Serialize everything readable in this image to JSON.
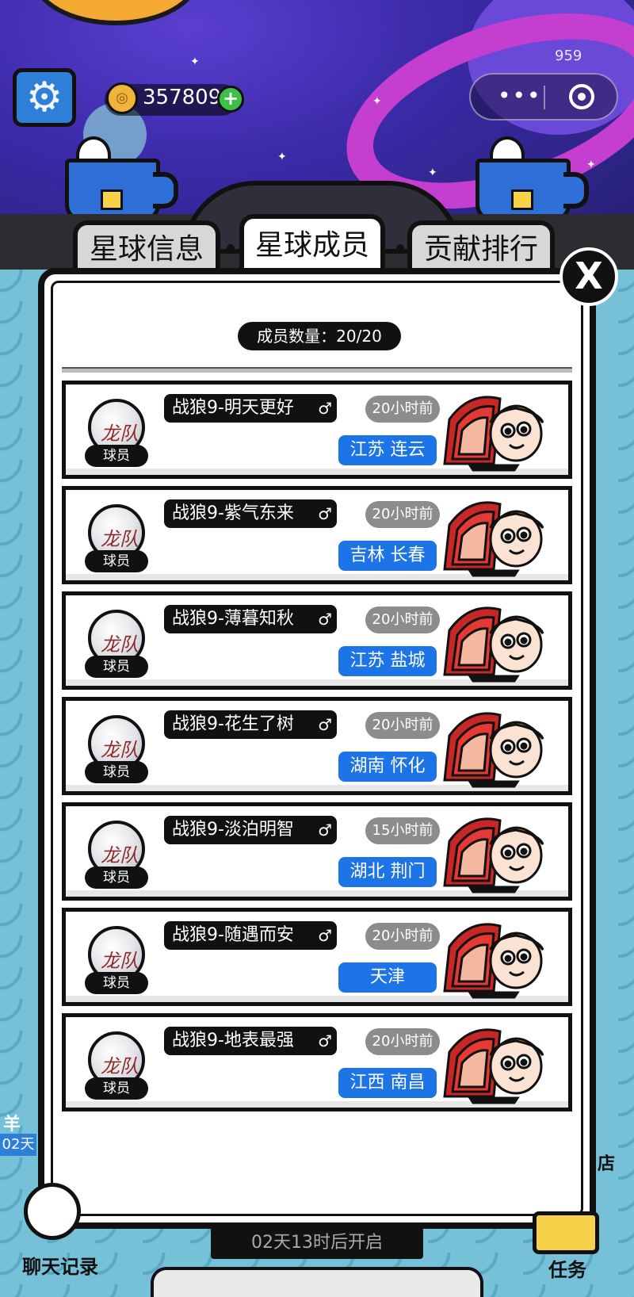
{
  "hud": {
    "coins": "357809",
    "mini_program_counter": "959"
  },
  "tabs": [
    {
      "label": "星球信息",
      "active": false
    },
    {
      "label": "星球成员",
      "active": true
    },
    {
      "label": "贡献排行",
      "active": false
    }
  ],
  "modal": {
    "close_label": "X",
    "member_count": "成员数量：20/20"
  },
  "members": [
    {
      "name": "战狼9-明天更好",
      "role": "球员",
      "last_active": "20小时前",
      "location": "江苏 连云",
      "gender_icon": "male-icon"
    },
    {
      "name": "战狼9-紫气东来",
      "role": "球员",
      "last_active": "20小时前",
      "location": "吉林 长春",
      "gender_icon": "male-icon"
    },
    {
      "name": "战狼9-薄暮知秋",
      "role": "球员",
      "last_active": "20小时前",
      "location": "江苏 盐城",
      "gender_icon": "male-icon"
    },
    {
      "name": "战狼9-花生了树",
      "role": "球员",
      "last_active": "20小时前",
      "location": "湖南 怀化",
      "gender_icon": "male-icon"
    },
    {
      "name": "战狼9-淡泊明智",
      "role": "球员",
      "last_active": "15小时前",
      "location": "湖北 荆门",
      "gender_icon": "male-icon"
    },
    {
      "name": "战狼9-随遇而安",
      "role": "球员",
      "last_active": "20小时前",
      "location": "天津",
      "gender_icon": "male-icon"
    },
    {
      "name": "战狼9-地表最强",
      "role": "球员",
      "last_active": "20小时前",
      "location": "江西 南昌",
      "gender_icon": "male-icon"
    }
  ],
  "bottom": {
    "chat_label": "聊天记录",
    "task_label": "任务",
    "countdown": "02天13时后开启",
    "left_side_top": "羊",
    "left_side_badge": "02天",
    "right_side": "店"
  },
  "colors": {
    "location_badge": "#1d74e6",
    "time_badge": "#8c8c8c",
    "coin_plus": "#3bc147",
    "settings": "#2d7fd9"
  }
}
